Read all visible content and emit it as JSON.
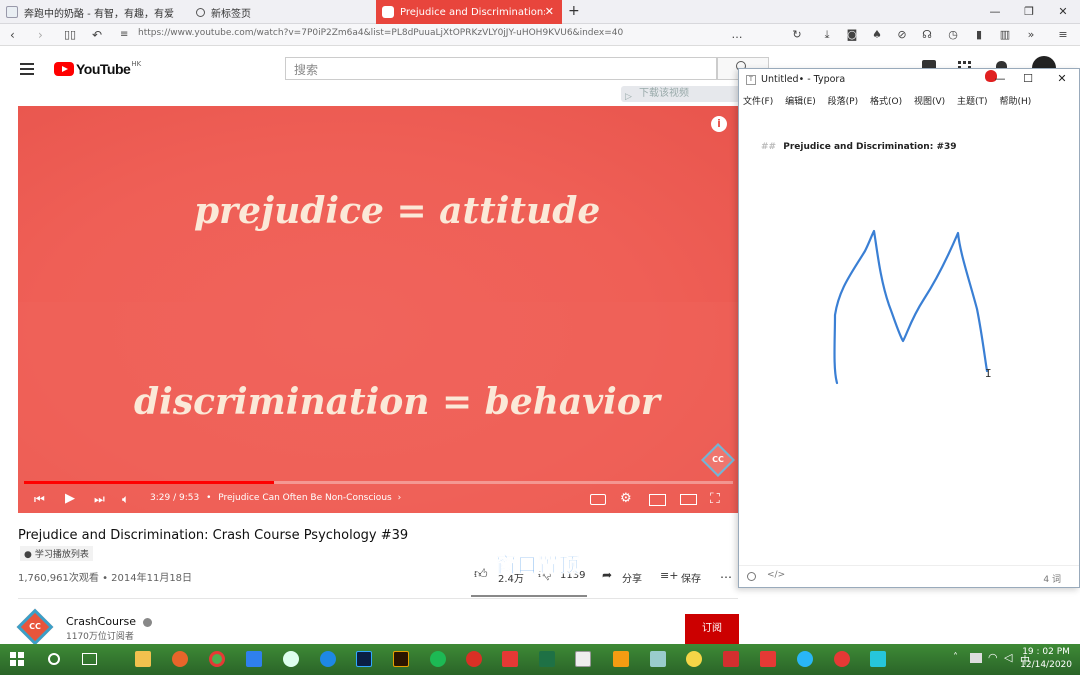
{
  "browser": {
    "tabs": [
      {
        "label": "奔跑中的奶酪 - 有智，有趣，有爱",
        "active": false
      },
      {
        "label": "新标签页",
        "active": false
      },
      {
        "label": "Prejudice and Discrimination: Crash",
        "active": true
      }
    ],
    "new_tab_label": "+",
    "url": "https://www.youtube.com/watch?v=7P0iP2Zm6a4&list=PL8dPuuaLjXtOPRKzVLY0jJY-uHOH9KVU6&index=40",
    "colors": {
      "active_tab": "#e8453c"
    }
  },
  "youtube": {
    "logo_text": "YouTube",
    "region": "HK",
    "search_placeholder": "搜索",
    "download_video_label": "下载该视频",
    "video": {
      "line1": "prejudice = attitude",
      "line2": "discrimination = behavior",
      "time": "3:29 / 9:53",
      "chapter": "Prejudice Can Often Be Non-Conscious",
      "progress_fraction": 0.352,
      "cc_label": "CC"
    },
    "title": "Prejudice and Discrimination: Crash Course Psychology #39",
    "playlist_tag": "学习播放列表",
    "views": "1,760,961次观看 • 2014年11月18日",
    "likes": "2.4万",
    "dislikes": "1139",
    "share_label": "分享",
    "save_label": "保存",
    "channel": {
      "name": "CrashCourse",
      "subscribers": "1170万位订阅者",
      "avatar_text": "CC"
    },
    "subscribe_label": "订阅",
    "colors": {
      "brand_red": "#ff0000",
      "subscribe": "#cc0000"
    }
  },
  "overlay_watermark": "窗口置顶",
  "typora": {
    "title": "Untitled• - Typora",
    "menu": [
      "文件(F)",
      "编辑(E)",
      "段落(P)",
      "格式(O)",
      "视图(V)",
      "主题(T)",
      "帮助(H)"
    ],
    "heading_marker": "##",
    "heading": "Prejudice and Discrimination: #39",
    "word_count": "4 词"
  },
  "taskbar": {
    "time": "19 : 02 PM",
    "date": "12/14/2020",
    "ime": "中"
  }
}
